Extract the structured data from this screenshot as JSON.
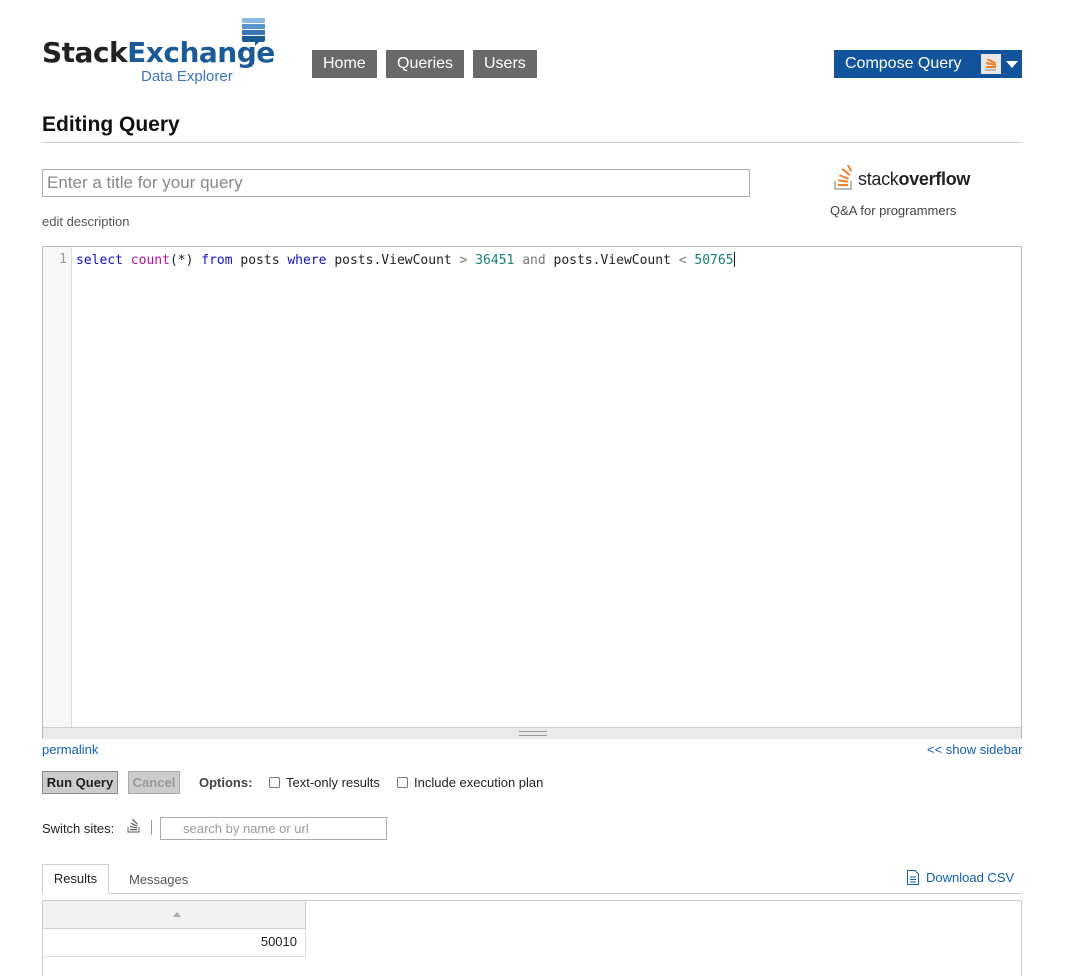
{
  "logo": {
    "part1": "Stack",
    "part2": "Exchange",
    "subtitle": "Data Explorer"
  },
  "nav": {
    "home": "Home",
    "queries": "Queries",
    "users": "Users",
    "compose": "Compose Query"
  },
  "colors": {
    "nav_bg": "#696969",
    "compose_bg": "#12549b",
    "link": "#1060b0",
    "so_orange": "#f48024"
  },
  "page": {
    "title": "Editing Query"
  },
  "query_title": {
    "value": "",
    "placeholder": "Enter a title for your query"
  },
  "edit_description": "edit description",
  "site": {
    "name_light": "stack",
    "name_bold": "overflow",
    "tagline": "Q&A for programmers"
  },
  "editor": {
    "line_number": "1",
    "tokens": {
      "select": "select",
      "count": "count",
      "args": "(*)",
      "from": "from",
      "table": "posts",
      "where": "where",
      "col1": "posts.ViewCount",
      "op1": ">",
      "val1": "36451",
      "and": "and",
      "col2": "posts.ViewCount",
      "op2": "<",
      "val2": "50765"
    }
  },
  "links": {
    "permalink": "permalink",
    "show_sidebar": "<< show sidebar"
  },
  "actions": {
    "run": "Run Query",
    "cancel": "Cancel",
    "options_label": "Options:",
    "text_only": "Text-only results",
    "exec_plan": "Include execution plan"
  },
  "switch_sites": {
    "label": "Switch sites:",
    "placeholder": "search by name or url"
  },
  "results": {
    "tabs": [
      "Results",
      "Messages"
    ],
    "download": "Download CSV",
    "rows": [
      {
        "value": "50010"
      }
    ]
  }
}
